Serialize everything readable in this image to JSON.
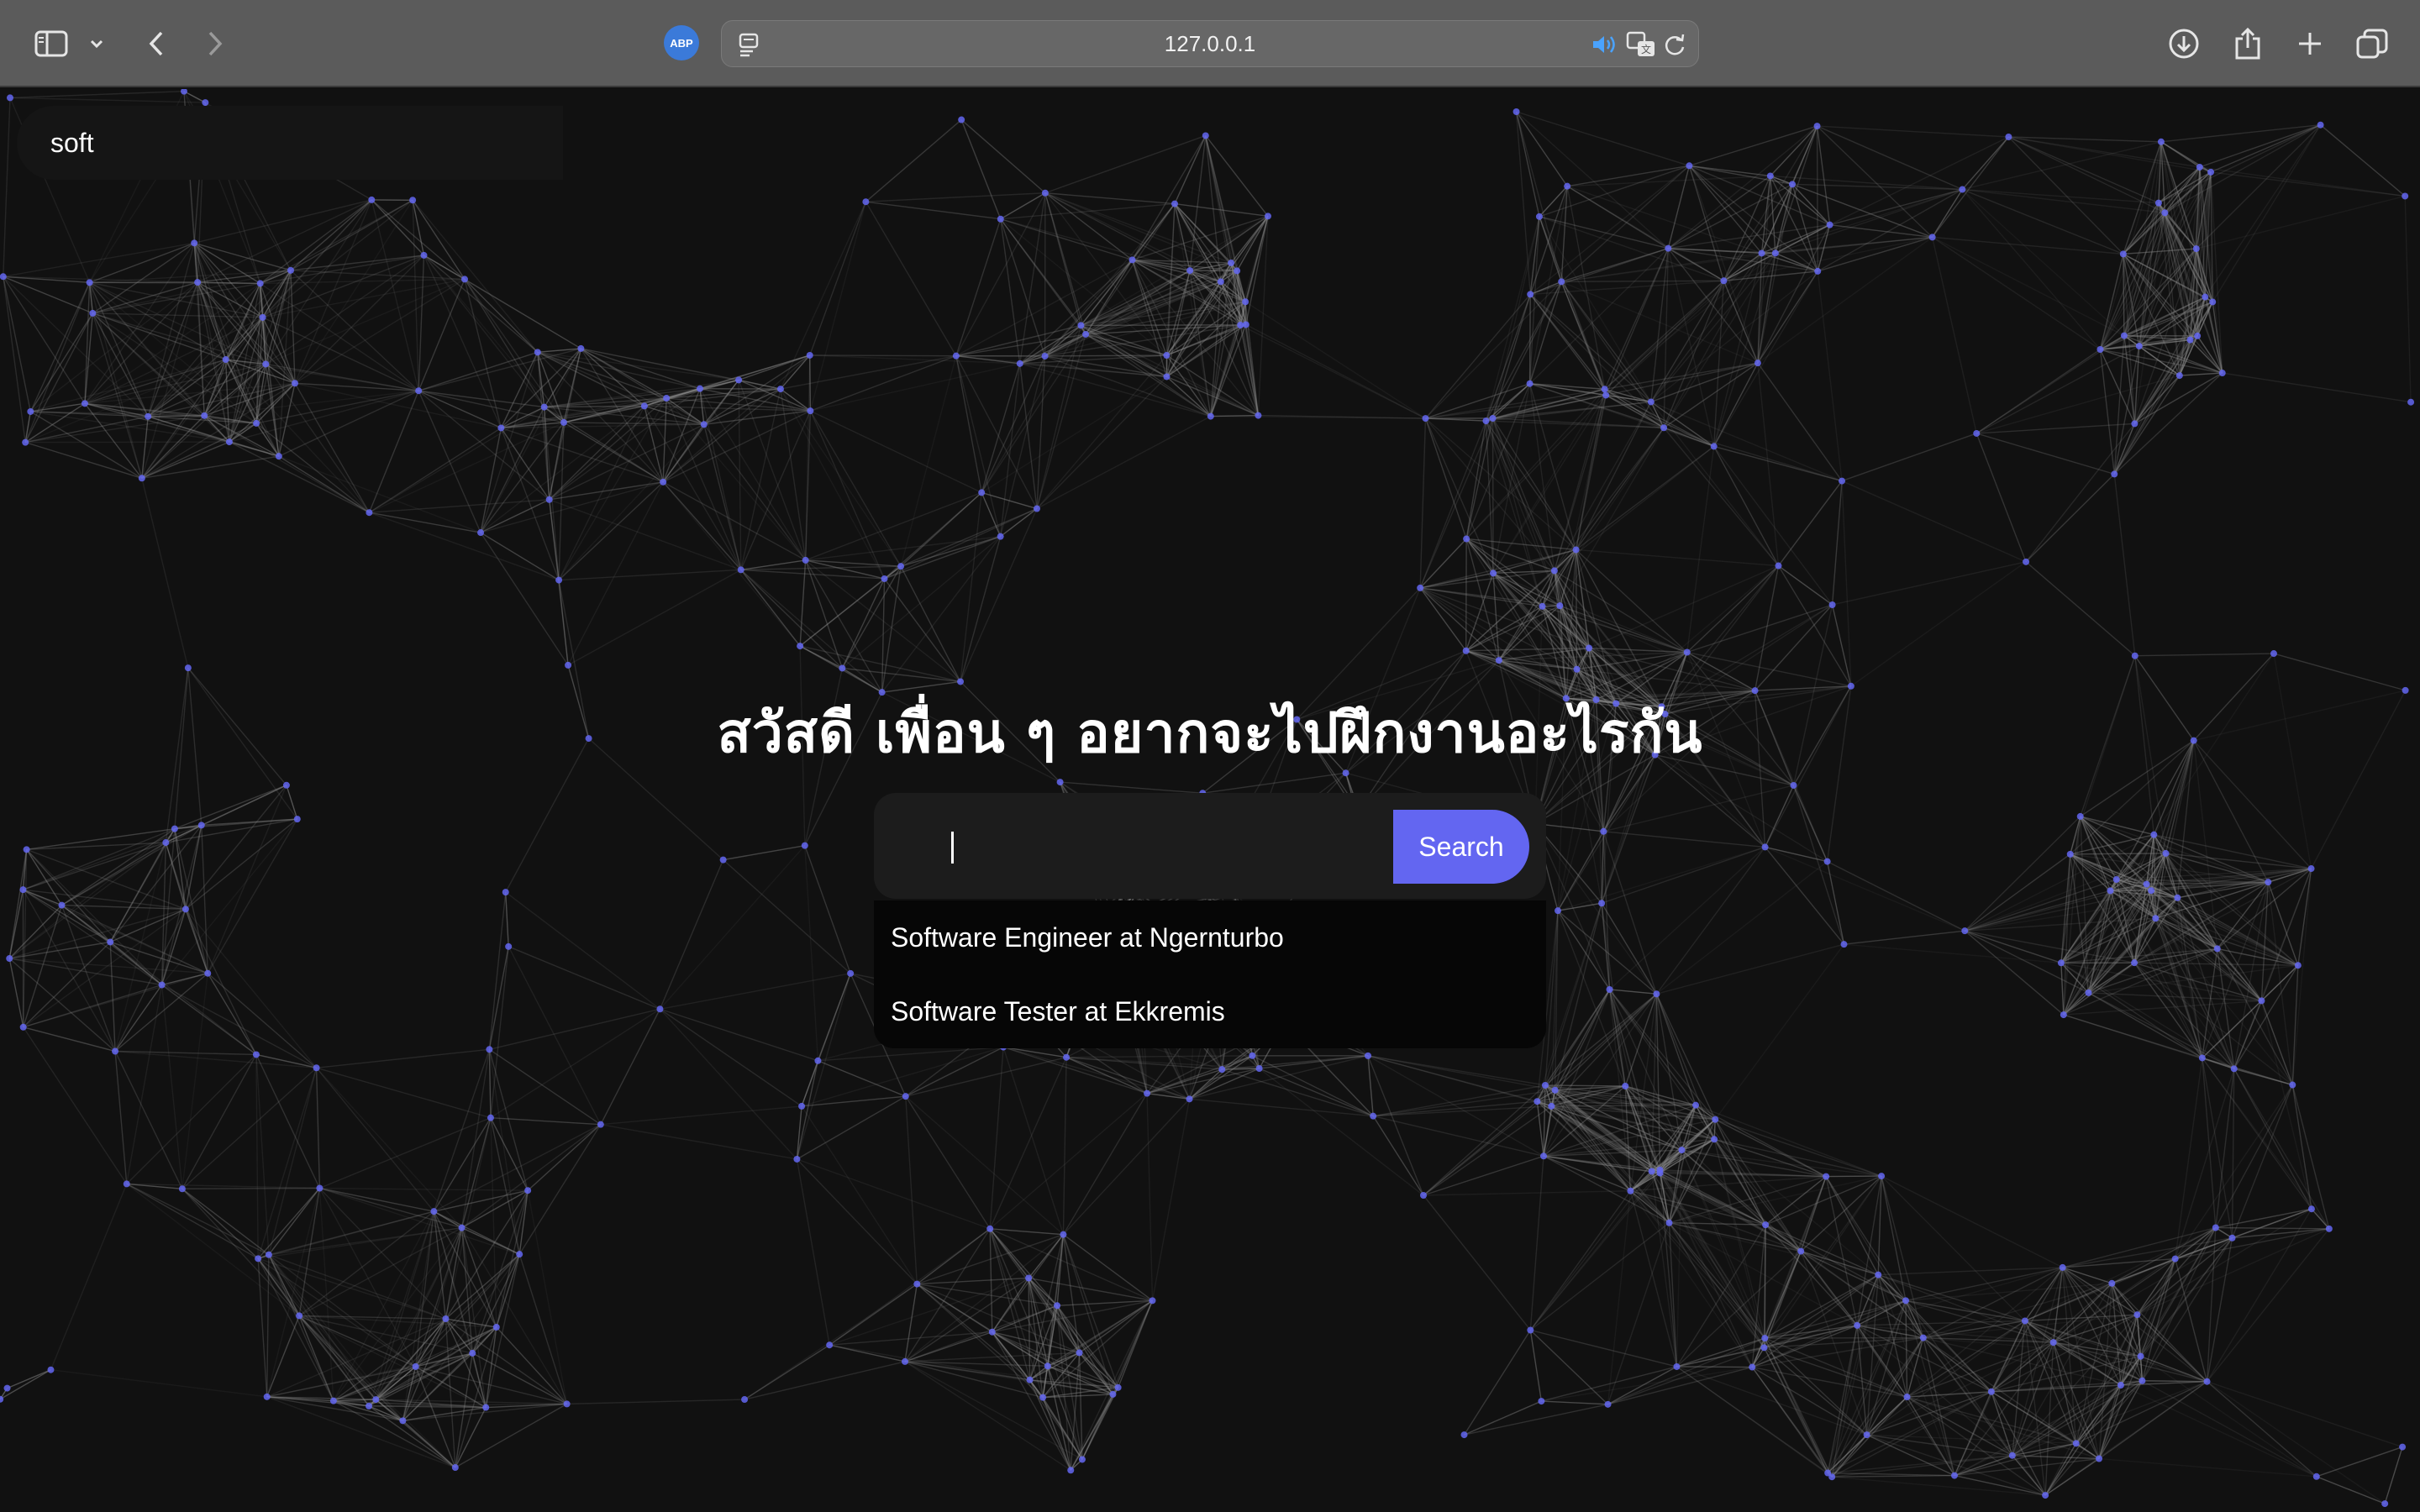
{
  "browser": {
    "url": "127.0.0.1",
    "extension_badge": "ABP",
    "icons": [
      "sidebar-icon",
      "chevron-down-icon",
      "back-icon",
      "forward-icon",
      "reader-icon",
      "audio-icon",
      "translate-icon",
      "reload-icon",
      "download-icon",
      "share-icon",
      "new-tab-icon",
      "tabs-overview-icon"
    ]
  },
  "main": {
    "headline": "สวัสดี เพื่อน ๆ อยากจะไปฝึกงานอะไรกัน",
    "search": {
      "value": "soft",
      "button_label": "Search"
    },
    "suggestions": [
      {
        "label": "Software Engineer at Ngernturbo"
      },
      {
        "label": "Software Tester at Ekkremis"
      }
    ]
  },
  "colors": {
    "background": "#111111",
    "accent": "#6366f1",
    "network_lines": "#8a8a8a",
    "network_nodes": "#6366f1"
  }
}
